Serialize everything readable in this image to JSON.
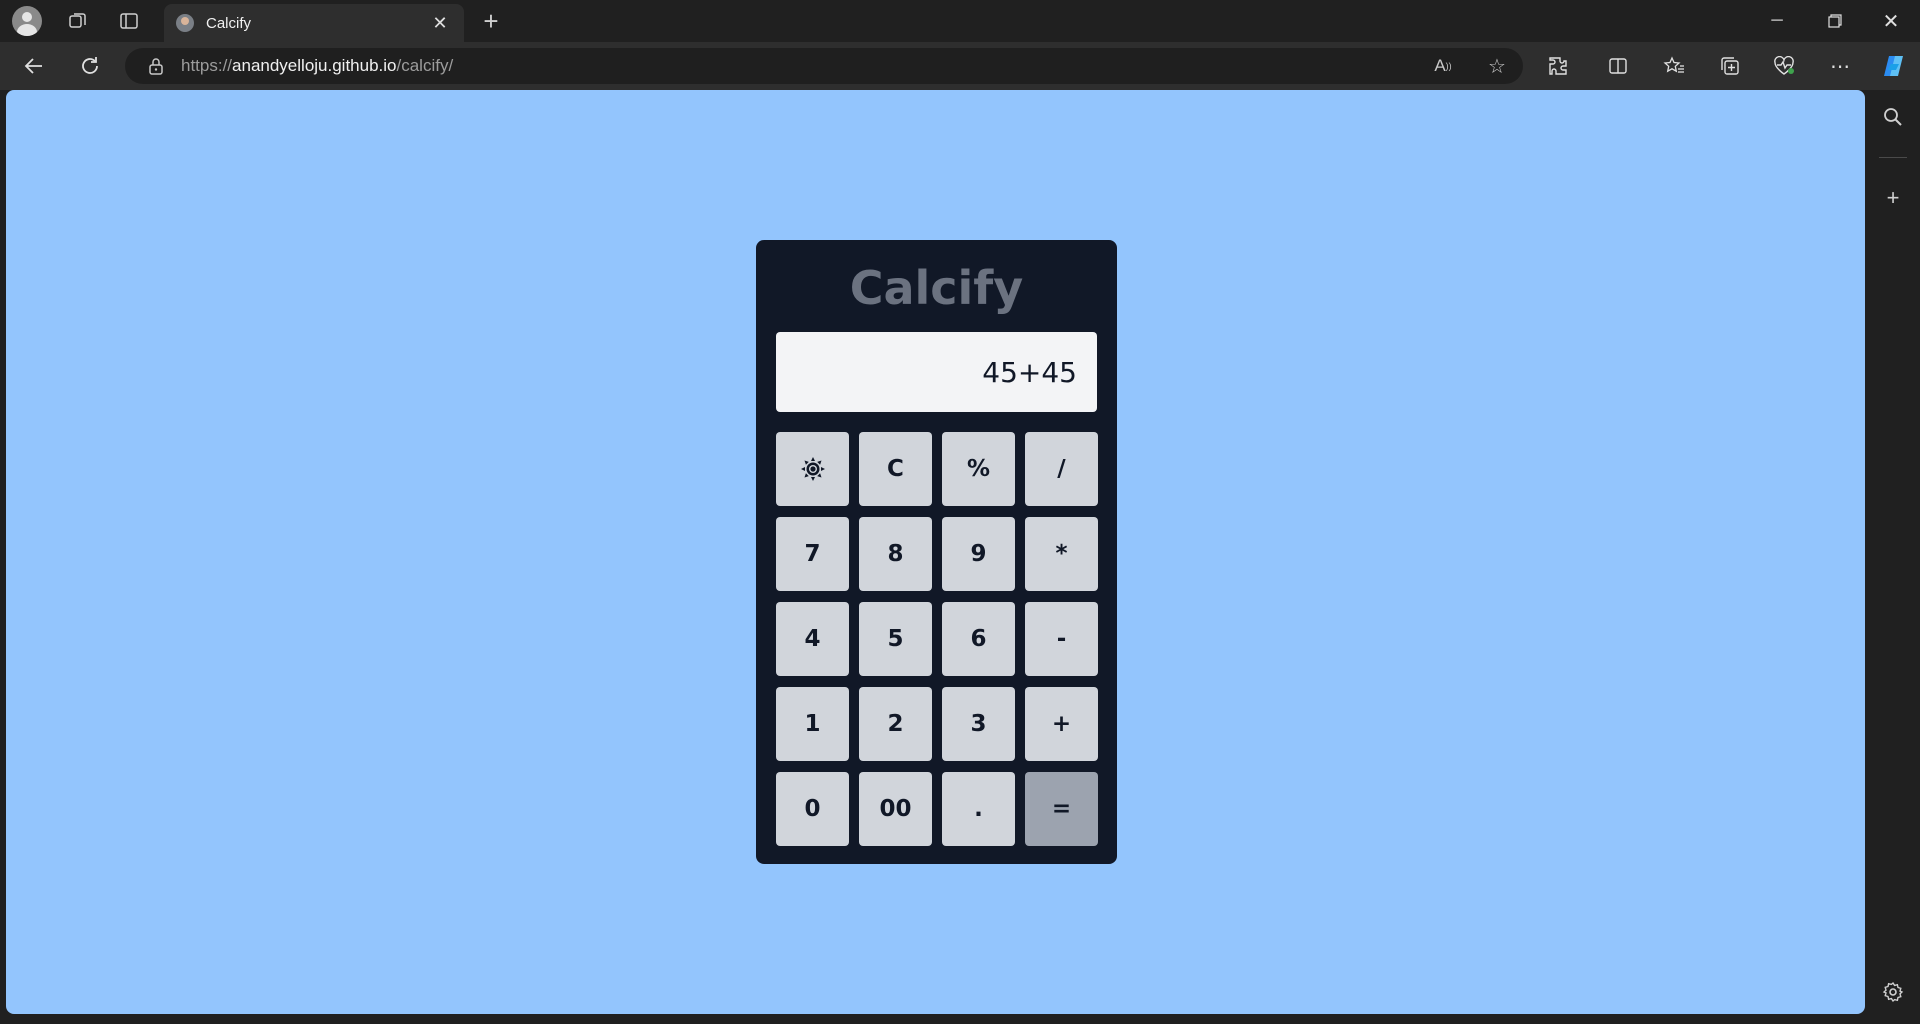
{
  "browser": {
    "tab": {
      "title": "Calcify"
    },
    "address": {
      "scheme": "https://",
      "host": "anandyelloju.github.io",
      "path": "/calcify/"
    }
  },
  "page": {
    "background_color": "#93c5fd",
    "calculator": {
      "title": "Calcify",
      "display_value": "45+45",
      "keys": [
        {
          "label": "",
          "icon": "sun-icon",
          "name": "theme-toggle-button"
        },
        {
          "label": "C",
          "name": "clear-button"
        },
        {
          "label": "%",
          "name": "percent-button"
        },
        {
          "label": "/",
          "name": "divide-button"
        },
        {
          "label": "7",
          "name": "digit-7-button"
        },
        {
          "label": "8",
          "name": "digit-8-button"
        },
        {
          "label": "9",
          "name": "digit-9-button"
        },
        {
          "label": "*",
          "name": "multiply-button"
        },
        {
          "label": "4",
          "name": "digit-4-button"
        },
        {
          "label": "5",
          "name": "digit-5-button"
        },
        {
          "label": "6",
          "name": "digit-6-button"
        },
        {
          "label": "-",
          "name": "subtract-button"
        },
        {
          "label": "1",
          "name": "digit-1-button"
        },
        {
          "label": "2",
          "name": "digit-2-button"
        },
        {
          "label": "3",
          "name": "digit-3-button"
        },
        {
          "label": "+",
          "name": "add-button"
        },
        {
          "label": "0",
          "name": "digit-0-button"
        },
        {
          "label": "00",
          "name": "double-zero-button"
        },
        {
          "label": ".",
          "name": "decimal-button"
        },
        {
          "label": "=",
          "name": "equals-button"
        }
      ]
    }
  }
}
